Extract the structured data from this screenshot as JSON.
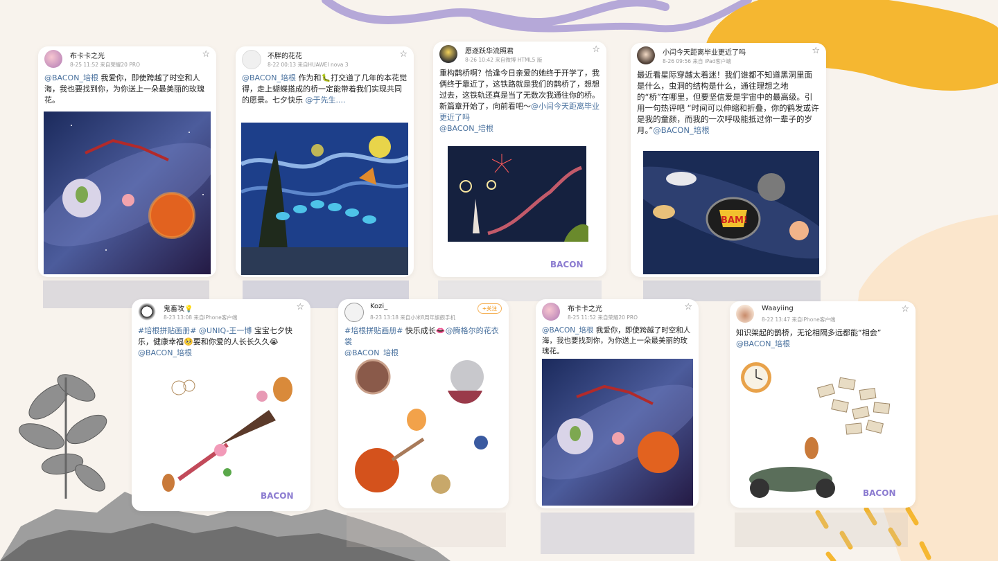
{
  "colors": {
    "background": "#f8f3ed",
    "accent_yellow": "#f5b731",
    "accent_lavender": "#b5a8d8",
    "link_blue": "#48709d",
    "bacon_purple": "#8b7bd0"
  },
  "posts": [
    {
      "user": "布卡卡之光",
      "meta": "8-25 11:52  来自荣耀20 PRO",
      "mention": "@BACON_培根",
      "text": " 我爱你，即使跨越了时空和人海，我也要找到你，为你送上一朵最美丽的玫瑰花。",
      "image": "space-collage"
    },
    {
      "user": "不胖的花花",
      "meta": "8-22 00:13  来自HUAWEI nova 3",
      "mention": "@BACON_培根",
      "text": " 作为和🐛打交道了几年的本花觉得，走上蝴蝶搭成的桥一定能带着我们实现共同的愿景。七夕快乐 ",
      "mention2": "@于先生....",
      "image": "starry-night-butterflies"
    },
    {
      "user": "愿逐跃华流照君",
      "meta": "8-26 10:42  来自微博 HTML5 版",
      "text": "重构鹊桥啊？恰逢今日亲爱的她终于开学了，我俩终于靠近了，这铁路就是我们的鹊桥了，想想过去，这铁轨还真是当了无数次我通往你的桥。新篇章开始了，向前看吧～",
      "mention": "@小闫今天距离毕业更近了吗",
      "mention2": "@BACON_培根",
      "image": "night-fireworks-bridge",
      "bacon": "BACON"
    },
    {
      "user": "小闫今天距离毕业更近了吗",
      "meta": "8-26 09:56  来自 iPad客户端",
      "text": "最近看星际穿越太着迷！我们谁都不知道黑洞里面是什么，虫洞的结构是什么，通往理想之地的“桥”在哪里，但要坚信爱是宇宙中的最高级。引用一句热评吧 “时间可以伸缩和折叠，你的鹤发或许是我的童颜，而我的一次呼吸能抵过你一辈子的岁月。”",
      "mention": "@BACON_培根",
      "image": "astronaut-bam",
      "bam": "BAM!"
    },
    {
      "user": "鬼畜攻💡",
      "meta": "8-23 13:08  来自iPhone客户端",
      "hashtag": "#培根拼贴画册#",
      "mention": " @UNIQ-王一博",
      "text": " 宝宝七夕快乐，健康幸福🥺要和你爱的人长长久久😭",
      "mention2": "@BACON_培根",
      "image": "cat-collage",
      "bacon": "BACON"
    },
    {
      "user": "Kozi_",
      "meta": "8-23 13:18  来自小米8周年旗舰手机",
      "follow": "+关注",
      "hashtag": "#培根拼贴画册#",
      "text": " 快乐成长👄",
      "mention": "@腾格尔的花衣裳",
      "mention2": "@BACON_培根",
      "image": "planets-collage"
    },
    {
      "user": "布卡卡之光",
      "meta": "8-25 11:52  来自荣耀20 PRO",
      "mention": "@BACON_培根",
      "text": " 我爱你，即使跨越了时空和人海，我也要找到你，为你送上一朵最美丽的玫瑰花。",
      "image": "space-collage"
    },
    {
      "user": "Waayiing",
      "meta": "8-22 13:47  来自iPhone客户端",
      "text": "知识架起的鹊桥，无论相隔多远都能“相会”",
      "mention": "@BACON_培根",
      "image": "books-scooter",
      "bacon": "BACON"
    }
  ]
}
